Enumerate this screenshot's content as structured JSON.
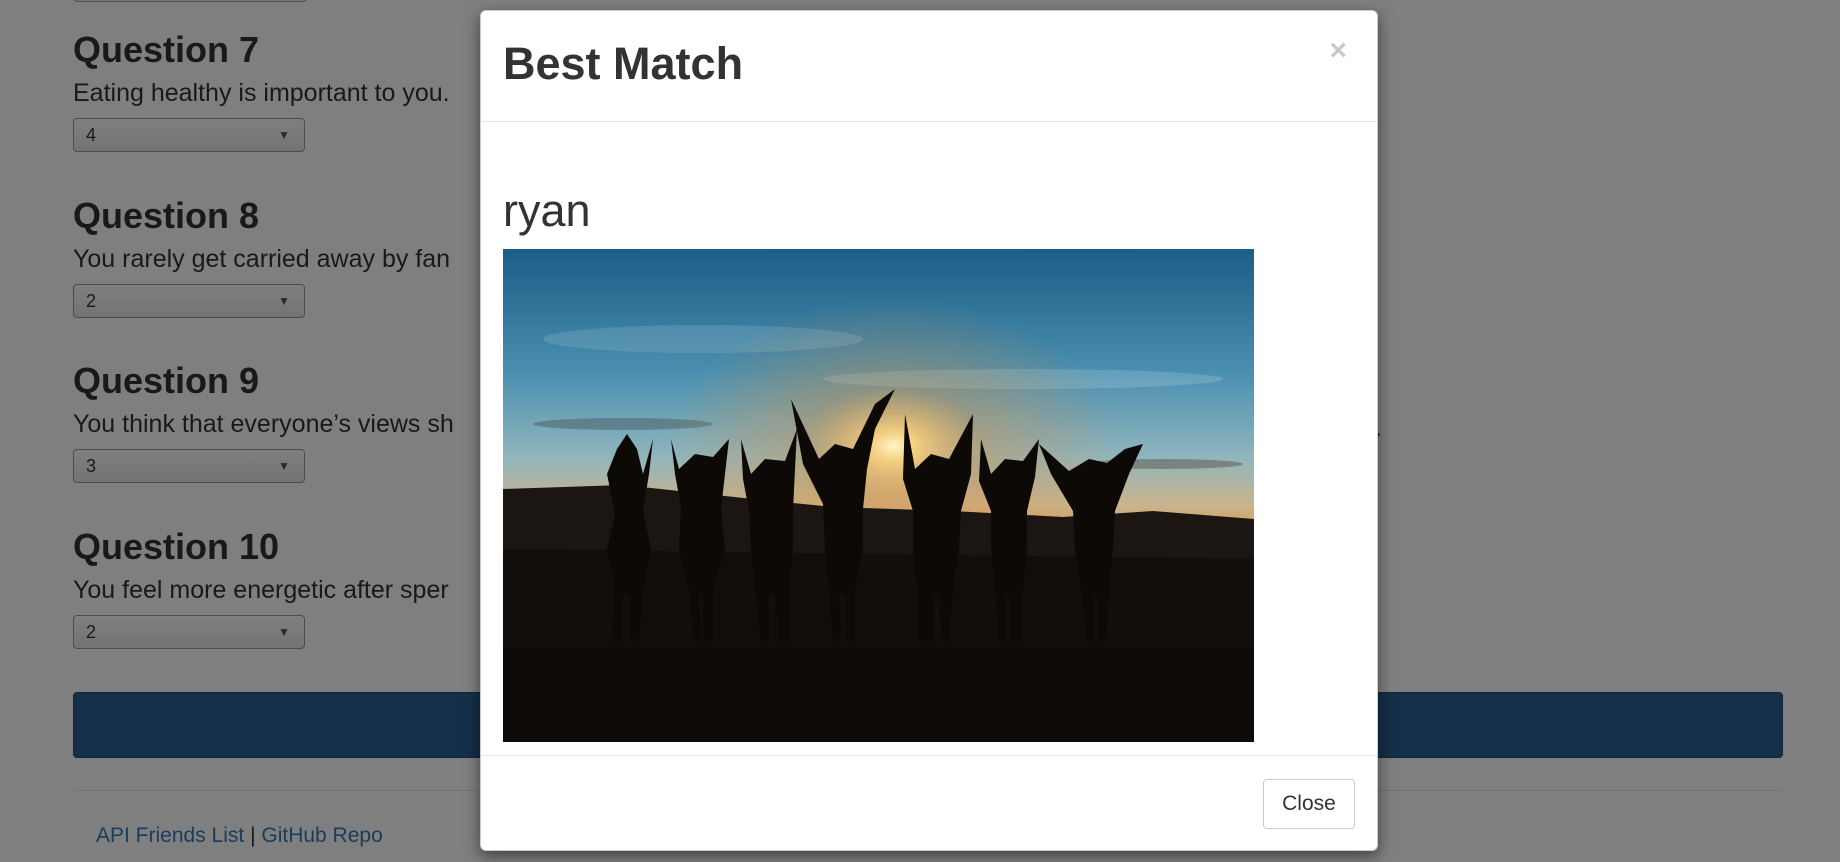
{
  "survey": {
    "questions": [
      {
        "title": "Question 7",
        "text": "Eating healthy is important to you.",
        "value": "4"
      },
      {
        "title": "Question 8",
        "text": "You rarely get carried away by fan",
        "value": "2"
      },
      {
        "title": "Question 9",
        "text": "You think that everyone’s views sh",
        "value": "3"
      },
      {
        "title": "Question 10",
        "text": "You feel more energetic after sper",
        "value": "2"
      }
    ],
    "trailing_text": "."
  },
  "footer": {
    "api_link": "API Friends List",
    "separator": " | ",
    "github_link": "GitHub Repo"
  },
  "modal": {
    "title": "Best Match",
    "close_symbol": "×",
    "match_name": "ryan",
    "close_button": "Close",
    "photo_alt": "Group of friends silhouetted against a sunset with arms raised"
  },
  "colors": {
    "backdrop": "rgba(0,0,0,0.5)",
    "submit_button": "#285e8e",
    "link": "#337ab7"
  }
}
